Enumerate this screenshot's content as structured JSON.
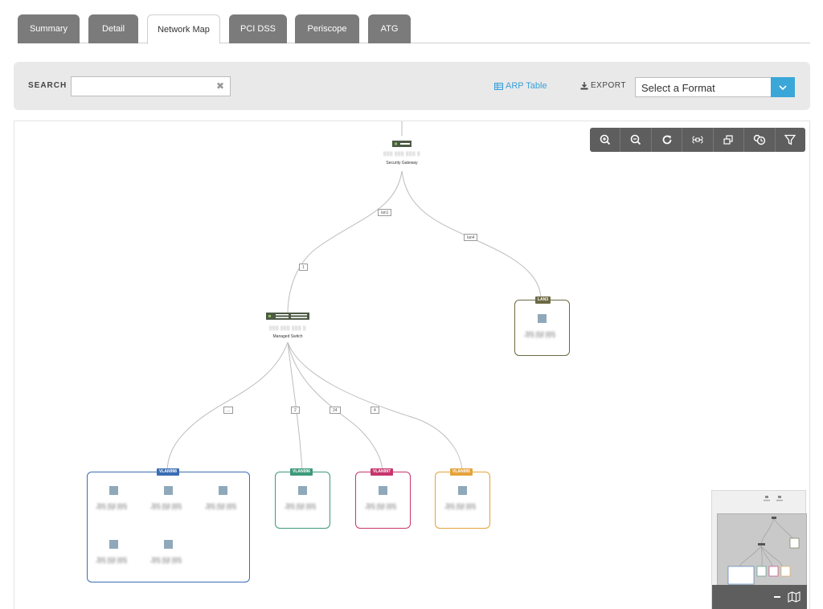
{
  "tabs": [
    {
      "label": "Summary"
    },
    {
      "label": "Detail"
    },
    {
      "label": "Network Map"
    },
    {
      "label": "PCI DSS"
    },
    {
      "label": "Periscope"
    },
    {
      "label": "ATG"
    }
  ],
  "active_tab": "Network Map",
  "toolbar": {
    "search_label": "SEARCH",
    "search_value": "",
    "arp_label": "ARP Table",
    "export_label": "EXPORT",
    "format_value": "Select a Format"
  },
  "map": {
    "gateway": {
      "name": "Security Gateway",
      "address": "(blurred)"
    },
    "switch": {
      "name": "Managed Switch",
      "address": "(blurred)"
    },
    "ports": {
      "lan1": "lan1",
      "lan4": "lan4",
      "p1": "1",
      "pdots": "...",
      "p2": "2",
      "p24": "24",
      "p4": "4"
    },
    "vlans": [
      {
        "tag": "LAN3",
        "color": "#6b6a44",
        "device_count": 1
      },
      {
        "tag": "VLAN998",
        "color": "#3b6db4",
        "device_count": 5
      },
      {
        "tag": "VLAN996",
        "color": "#3c9a7a",
        "device_count": 1
      },
      {
        "tag": "VLAN997",
        "color": "#c7356d",
        "device_count": 1
      },
      {
        "tag": "VLAN995",
        "color": "#e5a33a",
        "device_count": 1
      }
    ]
  },
  "controls": [
    "zoom-in-icon",
    "zoom-out-icon",
    "refresh-icon",
    "fit-icon",
    "layout-icon",
    "history-icon",
    "filter-icon"
  ],
  "colors": {
    "accent": "#3aa7d8",
    "tab_inactive": "#7b7b7b",
    "control_bar": "#5e5e5e"
  }
}
